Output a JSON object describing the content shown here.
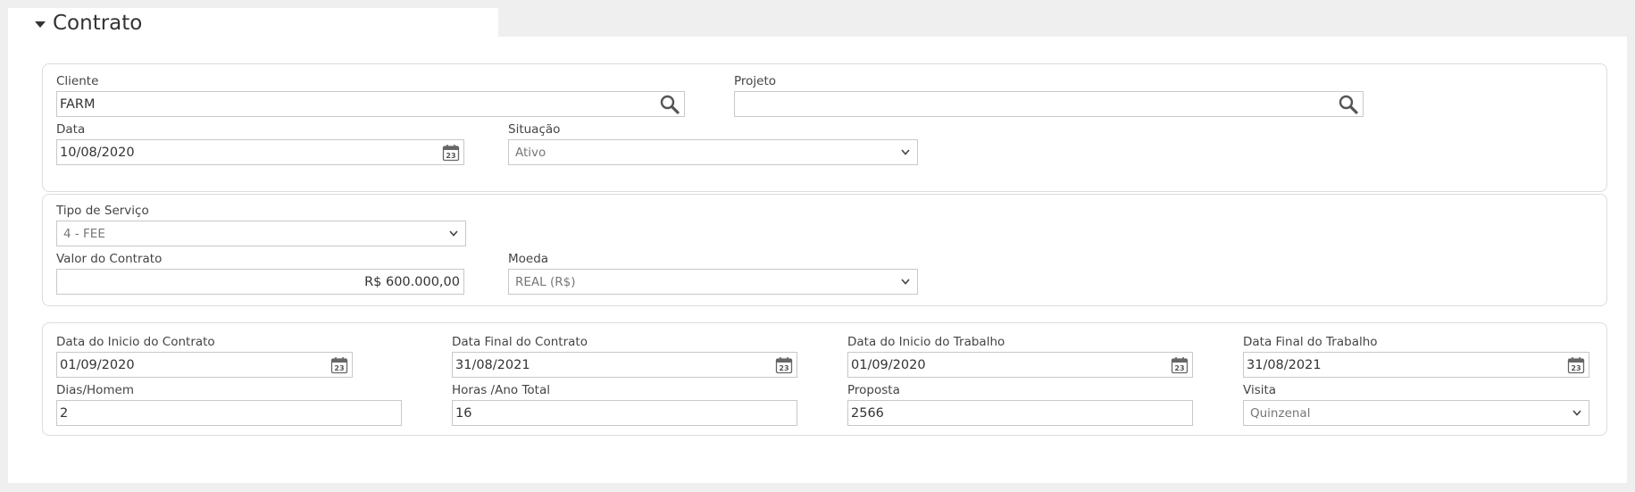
{
  "section": {
    "title": "Contrato"
  },
  "cliente": {
    "label": "Cliente",
    "value": "FARM"
  },
  "projeto": {
    "label": "Projeto",
    "value": ""
  },
  "data": {
    "label": "Data",
    "value": "10/08/2020"
  },
  "situacao": {
    "label": "Situação",
    "value": "Ativo"
  },
  "tipo_servico": {
    "label": "Tipo de Serviço",
    "value": "4 - FEE"
  },
  "valor_contrato": {
    "label": "Valor do Contrato",
    "value": "R$ 600.000,00"
  },
  "moeda": {
    "label": "Moeda",
    "value": "REAL (R$)"
  },
  "inicio_contrato": {
    "label": "Data do Inicio do Contrato",
    "value": "01/09/2020"
  },
  "final_contrato": {
    "label": "Data Final do Contrato",
    "value": "31/08/2021"
  },
  "inicio_trabalho": {
    "label": "Data do Inicio do Trabalho",
    "value": "01/09/2020"
  },
  "final_trabalho": {
    "label": "Data Final do Trabalho",
    "value": "31/08/2021"
  },
  "dias_homem": {
    "label": "Dias/Homem",
    "value": "2"
  },
  "horas_ano": {
    "label": "Horas /Ano Total",
    "value": "16"
  },
  "proposta": {
    "label": "Proposta",
    "value": "2566"
  },
  "visita": {
    "label": "Visita",
    "value": "Quinzenal"
  },
  "calendar_day": "23",
  "icons": {
    "lookup": "search-icon",
    "date": "calendar-icon",
    "dropdown": "chevron-down-icon",
    "toggle": "caret-down-icon"
  }
}
